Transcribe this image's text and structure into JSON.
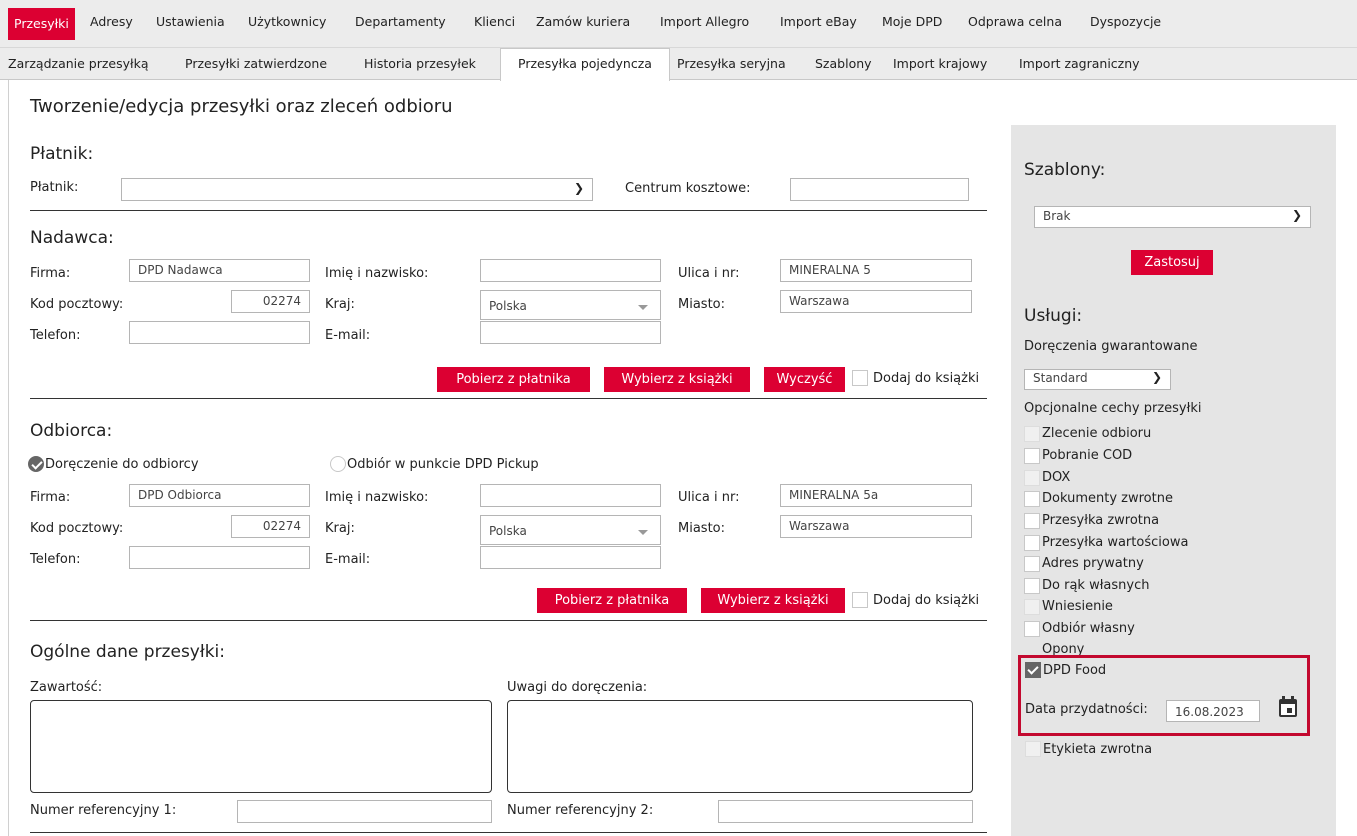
{
  "nav_main": {
    "active": "Przesyłki",
    "items": [
      "Adresy",
      "Ustawienia",
      "Użytkownicy",
      "Departamenty",
      "Klienci",
      "Zamów kuriera",
      "Import Allegro",
      "Import eBay",
      "Moje DPD",
      "Odprawa celna",
      "Dyspozycje"
    ]
  },
  "nav_sub": {
    "items_left": [
      "Zarządzanie przesyłką",
      "Przesyłki zatwierdzone",
      "Historia przesyłek"
    ],
    "active": "Przesyłka pojedyncza",
    "items_right": [
      "Przesyłka seryjna",
      "Szablony",
      "Import krajowy",
      "Import zagraniczny"
    ]
  },
  "page_title": "Tworzenie/edycja przesyłki oraz zleceń odbioru",
  "payer": {
    "heading": "Płatnik:",
    "label": "Płatnik:",
    "value": "",
    "cost_center_label": "Centrum kosztowe:",
    "cost_center_value": ""
  },
  "sender": {
    "heading": "Nadawca:",
    "company_label": "Firma:",
    "company": "DPD Nadawca",
    "name_label": "Imię i nazwisko:",
    "name": "",
    "street_label": "Ulica i nr:",
    "street": "MINERALNA 5",
    "postal_label": "Kod pocztowy:",
    "postal": "02274",
    "country_label": "Kraj:",
    "country": "Polska",
    "city_label": "Miasto:",
    "city": "Warszawa",
    "phone_label": "Telefon:",
    "phone": "",
    "email_label": "E-mail:",
    "email": "",
    "btn_payer": "Pobierz z płatnika",
    "btn_book": "Wybierz z książki",
    "btn_clear": "Wyczyść",
    "add_to_book": "Dodaj do książki"
  },
  "receiver": {
    "heading": "Odbiorca:",
    "radio_delivery": "Doręczenie do odbiorcy",
    "radio_pickup": "Odbiór w punkcie DPD Pickup",
    "company_label": "Firma:",
    "company": "DPD Odbiorca",
    "name_label": "Imię i nazwisko:",
    "name": "",
    "street_label": "Ulica i nr:",
    "street": "MINERALNA 5a",
    "postal_label": "Kod pocztowy:",
    "postal": "02274",
    "country_label": "Kraj:",
    "country": "Polska",
    "city_label": "Miasto:",
    "city": "Warszawa",
    "phone_label": "Telefon:",
    "phone": "",
    "email_label": "E-mail:",
    "email": "",
    "btn_payer": "Pobierz z płatnika",
    "btn_book": "Wybierz z książki",
    "add_to_book": "Dodaj do książki"
  },
  "general": {
    "heading": "Ogólne dane przesyłki:",
    "content_label": "Zawartość:",
    "notes_label": "Uwagi do doręczenia:",
    "ref1_label": "Numer referencyjny 1:",
    "ref2_label": "Numer referencyjny 2:"
  },
  "sidebar": {
    "templates_heading": "Szablony:",
    "template_value": "Brak",
    "apply_button": "Zastosuj",
    "services_heading": "Usługi:",
    "guaranteed_label": "Doręczenia gwarantowane",
    "guaranteed_value": "Standard",
    "optional_label": "Opcjonalne cechy przesyłki",
    "options": [
      {
        "label": "Zlecenie odbioru",
        "state": "disabled"
      },
      {
        "label": "Pobranie COD",
        "state": "unchecked"
      },
      {
        "label": "DOX",
        "state": "disabled"
      },
      {
        "label": "Dokumenty zwrotne",
        "state": "unchecked"
      },
      {
        "label": "Przesyłka zwrotna",
        "state": "unchecked"
      },
      {
        "label": "Przesyłka wartościowa",
        "state": "unchecked"
      },
      {
        "label": "Adres prywatny",
        "state": "unchecked"
      },
      {
        "label": "Do rąk własnych",
        "state": "unchecked"
      },
      {
        "label": "Wniesienie",
        "state": "disabled"
      },
      {
        "label": "Odbiór własny",
        "state": "unchecked"
      },
      {
        "label": "Opony",
        "state": "disabled"
      },
      {
        "label": "DPD Food",
        "state": "checked"
      }
    ],
    "expiry_label": "Data przydatności:",
    "expiry_value": "16.08.2023",
    "return_label": "Etykieta zwrotna",
    "highlight_color": "#c3092f",
    "accent_color": "#dc0032"
  }
}
